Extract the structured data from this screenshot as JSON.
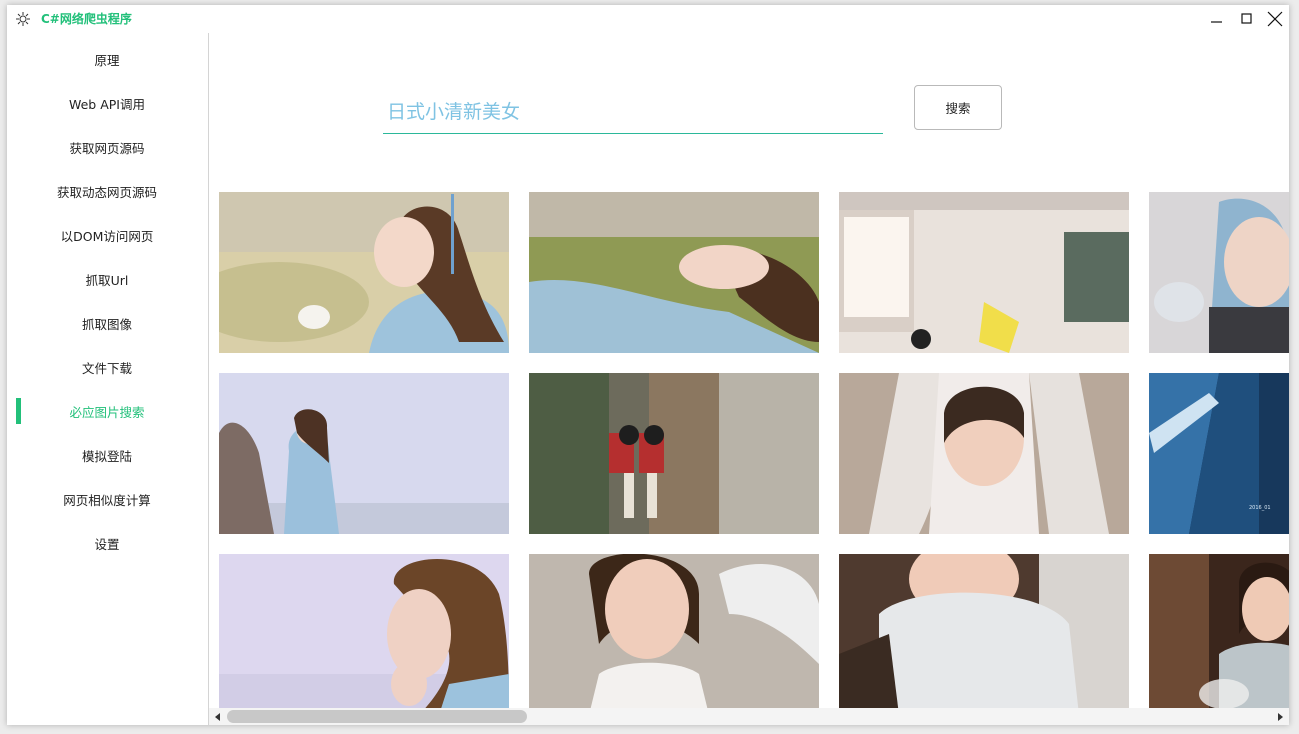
{
  "app": {
    "title": "C#网络爬虫程序",
    "accent": "#22c07a"
  },
  "window_controls": {
    "icons": [
      "minimize-icon",
      "maximize-icon",
      "close-icon"
    ]
  },
  "sidebar": {
    "items": [
      {
        "label": "原理",
        "active": false
      },
      {
        "label": "Web API调用",
        "active": false
      },
      {
        "label": "获取网页源码",
        "active": false
      },
      {
        "label": "获取动态网页源码",
        "active": false
      },
      {
        "label": "以DOM访问网页",
        "active": false
      },
      {
        "label": "抓取Url",
        "active": false
      },
      {
        "label": "抓取图像",
        "active": false
      },
      {
        "label": "文件下载",
        "active": false
      },
      {
        "label": "必应图片搜索",
        "active": true
      },
      {
        "label": "模拟登陆",
        "active": false
      },
      {
        "label": "网页相似度计算",
        "active": false
      },
      {
        "label": "设置",
        "active": false
      }
    ]
  },
  "search": {
    "value": "日式小清新美女",
    "button_label": "搜索"
  },
  "gallery": {
    "images": [
      {
        "name": "photo-girl-kimono-holding-flower"
      },
      {
        "name": "photo-girl-lying-on-grass"
      },
      {
        "name": "photo-sunlit-room-with-easel"
      },
      {
        "name": "photo-girl-hood-shielding-face"
      },
      {
        "name": "photo-girl-standing-by-sea"
      },
      {
        "name": "photo-anime-schoolgirls-street"
      },
      {
        "name": "photo-girl-raincoat-hood"
      },
      {
        "name": "photo-car-window-reflection"
      },
      {
        "name": "photo-girl-profile-hand-on-cheek"
      },
      {
        "name": "photo-girl-smiling-umbrella"
      },
      {
        "name": "photo-girl-knit-scarf"
      },
      {
        "name": "photo-girl-eating-snack"
      }
    ]
  }
}
